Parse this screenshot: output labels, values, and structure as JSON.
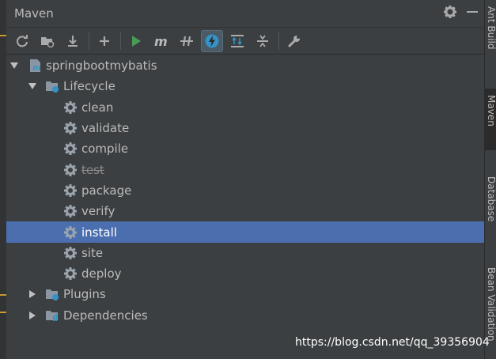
{
  "panel": {
    "title": "Maven"
  },
  "tree": {
    "project": "springbootmybatis",
    "lifecycle": {
      "label": "Lifecycle",
      "phases": [
        "clean",
        "validate",
        "compile",
        "test",
        "package",
        "verify",
        "install",
        "site",
        "deploy"
      ],
      "skipped": "test",
      "selected": "install"
    },
    "plugins": "Plugins",
    "dependencies": "Dependencies"
  },
  "right_tabs": [
    "Ant Build",
    "Maven",
    "Database",
    "Bean Validation"
  ],
  "watermark": "https://blog.csdn.net/qq_39356904",
  "colors": {
    "selection": "#4b6eaf",
    "run_green": "#499c54",
    "background": "#3c3f41"
  }
}
